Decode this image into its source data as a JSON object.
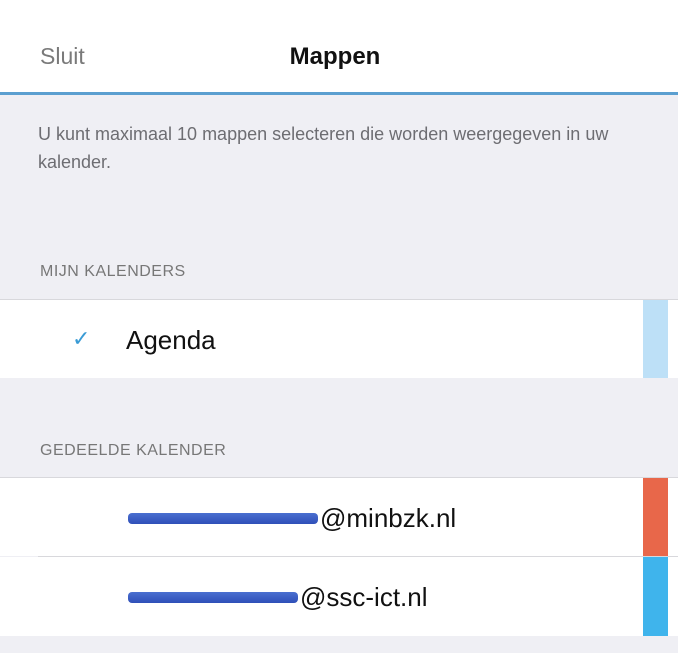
{
  "header": {
    "close_label": "Sluit",
    "title": "Mappen"
  },
  "info_text": "U kunt maximaal 10 mappen selecteren die worden weergegeven in uw kalender.",
  "my_calendars": {
    "section_label": "MIJN KALENDERS",
    "items": [
      {
        "label": "Agenda",
        "checked": true,
        "check_icon": "checkmark-icon",
        "color": "#bde0f7"
      }
    ]
  },
  "shared_calendars": {
    "section_label": "GEDEELDE KALENDER",
    "items": [
      {
        "label": "@minbzk.nl",
        "checked": false,
        "color": "#e8674a"
      },
      {
        "label": "@ssc-ict.nl",
        "checked": false,
        "color": "#3fb4ec"
      }
    ]
  }
}
